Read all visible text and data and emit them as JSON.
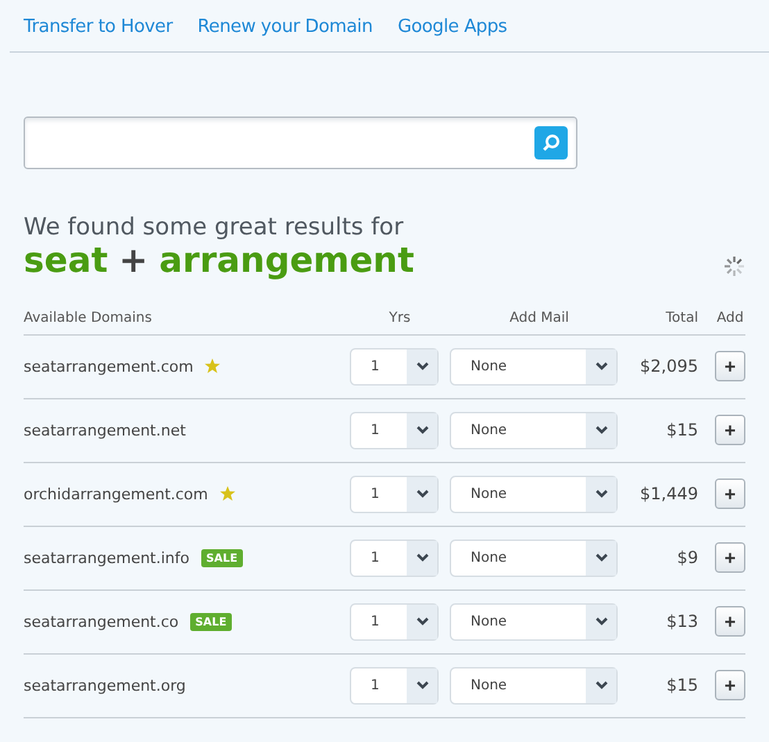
{
  "nav": [
    "Transfer to Hover",
    "Renew your Domain",
    "Google Apps"
  ],
  "results_heading": {
    "intro": "We found some great results for",
    "terms": [
      "seat",
      "arrangement"
    ],
    "joiner": "+"
  },
  "table": {
    "columns": [
      "Available Domains",
      "Yrs",
      "Add Mail",
      "Total",
      "Add"
    ],
    "rows": [
      {
        "domain": "seatarrangement.com",
        "starred": true,
        "years": "1",
        "mail": "None",
        "total": "$2,095",
        "add": "+"
      },
      {
        "domain": "seatarrangement.net",
        "starred": false,
        "years": "1",
        "mail": "None",
        "total": "$15",
        "add": "+"
      },
      {
        "domain": "orchidarrangement.com",
        "starred": true,
        "years": "1",
        "mail": "None",
        "total": "$1,449",
        "add": "+"
      },
      {
        "domain": "seatarrangement.info",
        "starred": false,
        "tag": "SALE",
        "years": "1",
        "mail": "None",
        "total": "$9",
        "add": "+"
      },
      {
        "domain": "seatarrangement.co",
        "starred": false,
        "tag": "SALE",
        "years": "1",
        "mail": "None",
        "total": "$13",
        "add": "+"
      },
      {
        "domain": "seatarrangement.org",
        "starred": false,
        "years": "1",
        "mail": "None",
        "total": "$15",
        "add": "+"
      }
    ]
  }
}
